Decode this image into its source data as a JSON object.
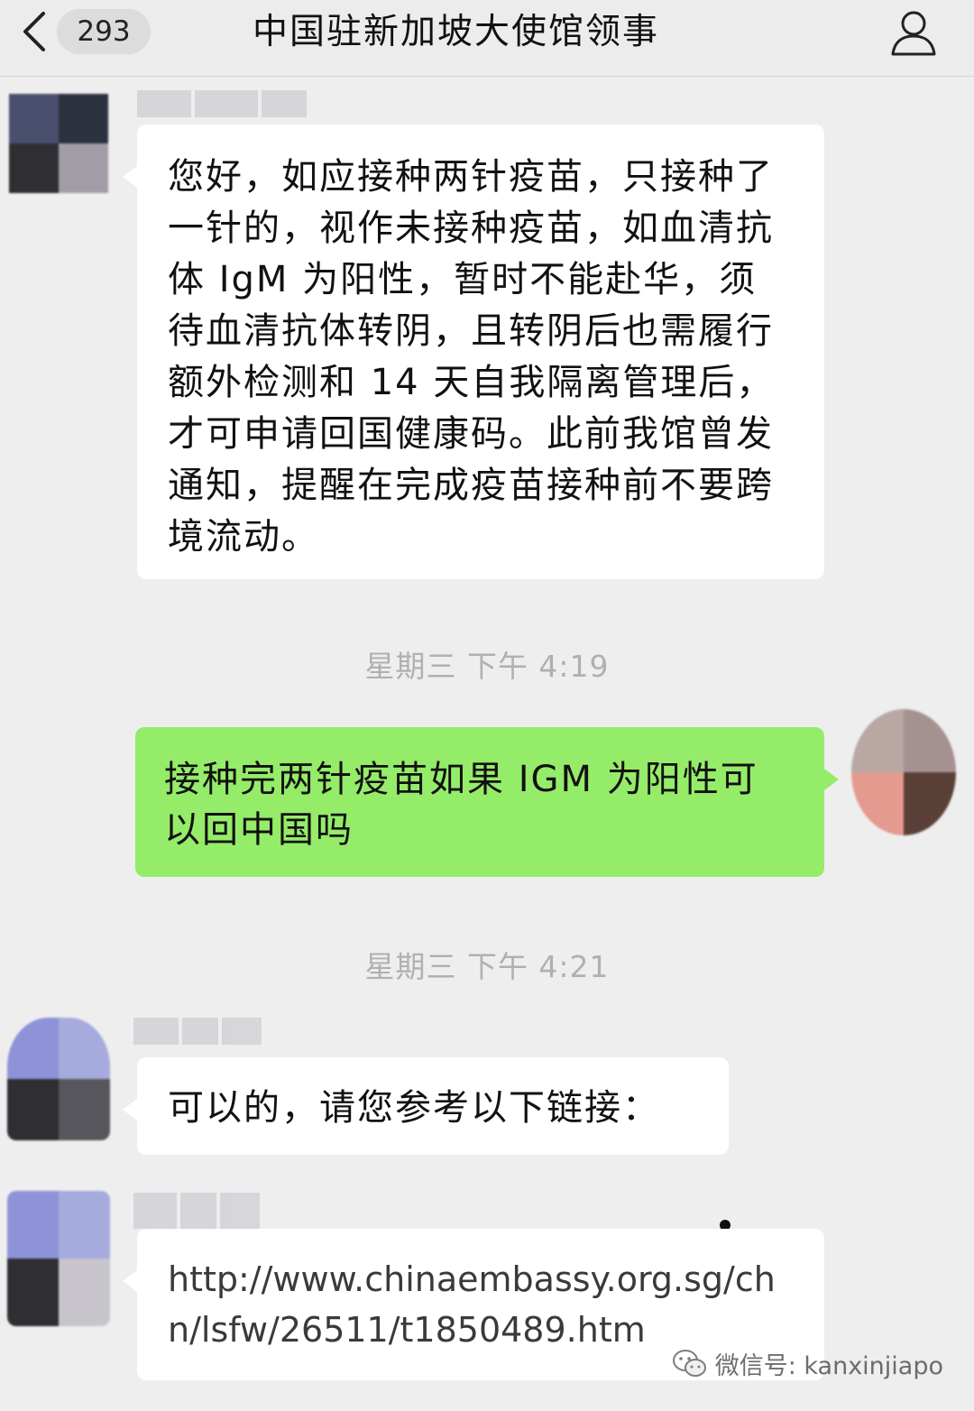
{
  "header": {
    "unread_count": "293",
    "title": "中国驻新加坡大使馆领事"
  },
  "messages": [
    {
      "side": "left",
      "text": "您好，如应接种两针疫苗，只接种了一针的，视作未接种疫苗，如血清抗体 IgM 为阳性，暂时不能赴华，须待血清抗体转阴，且转阴后也需履行额外检测和 14 天自我隔离管理后，才可申请回国健康码。此前我馆曾发通知，提醒在完成疫苗接种前不要跨境流动。"
    },
    {
      "side": "right",
      "text": "接种完两针疫苗如果 IGM 为阳性可以回中国吗"
    },
    {
      "side": "left",
      "text": "可以的，请您参考以下链接："
    },
    {
      "side": "left",
      "text": "http://www.chinaembassy.org.sg/chn/lsfw/26511/t1850489.htm"
    }
  ],
  "timestamps": [
    "星期三 下午 4:19",
    "星期三 下午 4:21"
  ],
  "watermark": {
    "label": "微信号: kanxinjiapo",
    "icon": "wechat-logo-icon"
  },
  "icons": {
    "back": "chevron-left-icon",
    "profile": "person-icon"
  },
  "colors": {
    "background": "#eeeeee",
    "outgoing_bubble": "#95ec69",
    "incoming_bubble": "#ffffff",
    "timestamp": "#b0b0b0"
  }
}
